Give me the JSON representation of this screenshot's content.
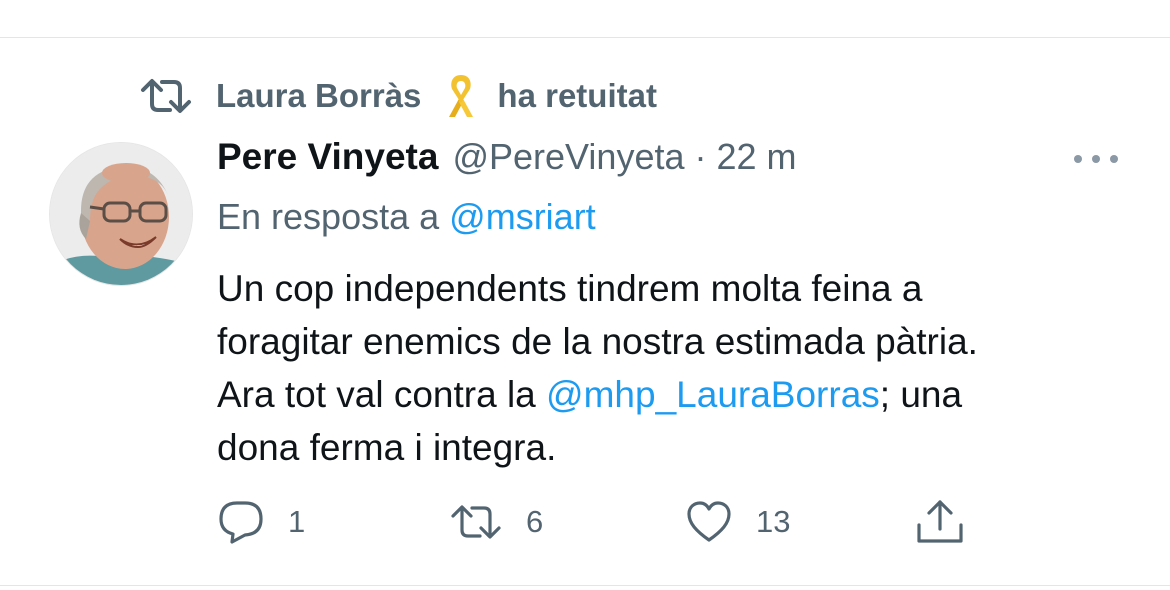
{
  "retweet": {
    "retweeter_name": "Laura Borràs",
    "retweet_icon": "retweet-icon",
    "ribbon_icon": "yellow-ribbon-icon",
    "retweet_text": "ha retuitat"
  },
  "tweet": {
    "avatar": "avatar",
    "display_name": "Pere Vinyeta",
    "handle": "@PereVinyeta",
    "separator": "·",
    "timestamp": "22 m",
    "more_icon": "more-icon",
    "reply_prefix": "En resposta a",
    "reply_mention": "@msriart",
    "text": {
      "line1": "Un cop independents tindrem molta feina a",
      "line2": "foragitar enemics de la nostra estimada pàtria.",
      "line3_before": "Ara tot val contra la ",
      "line3_mention": "@mhp_LauraBorras",
      "line3_after": "; una",
      "line4": "dona ferma i integra."
    }
  },
  "actions": {
    "reply_count": "1",
    "retweet_count": "6",
    "like_count": "13",
    "icons": [
      "reply-icon",
      "retweet-icon",
      "like-icon",
      "share-icon"
    ]
  },
  "colors": {
    "text": "#0f1419",
    "secondary": "#536471",
    "link": "#1d9bf0",
    "ribbon": "#f2c230"
  }
}
